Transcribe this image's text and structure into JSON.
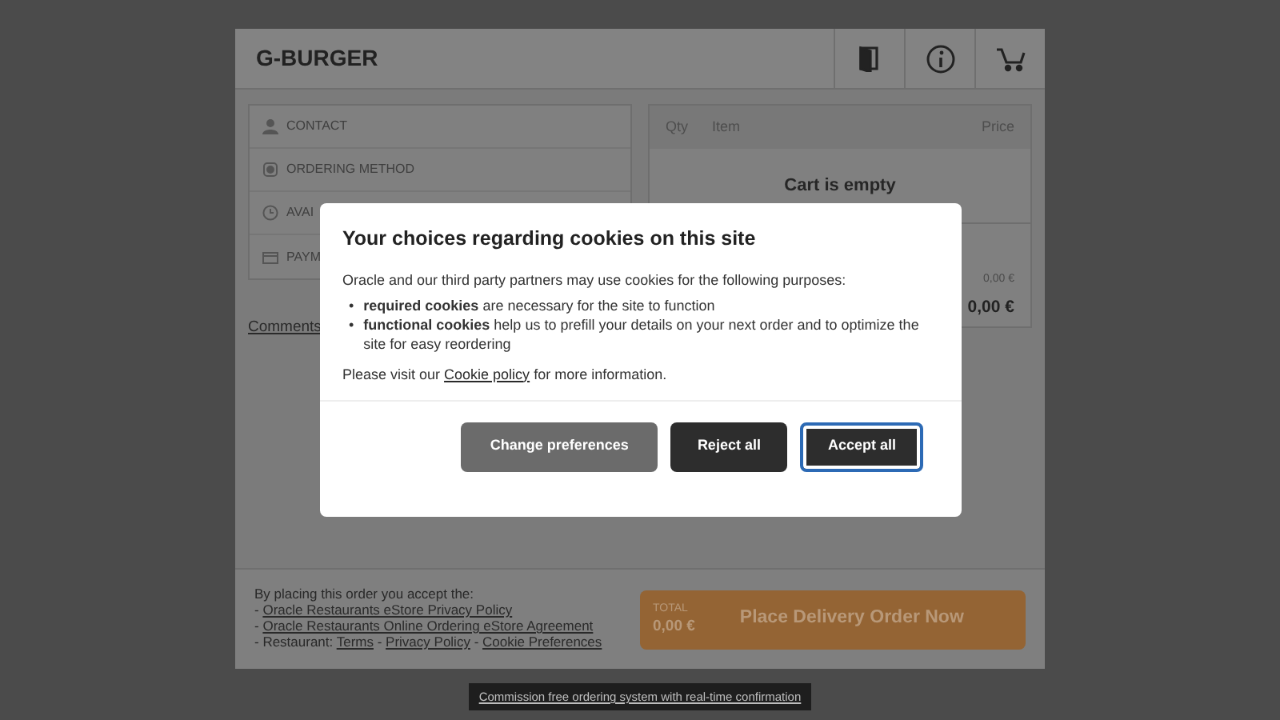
{
  "header": {
    "title": "G-BURGER",
    "buttons": [
      {
        "kind": "door"
      },
      {
        "kind": "info"
      },
      {
        "kind": "cart"
      }
    ]
  },
  "steps": [
    {
      "label": "CONTACT",
      "kind": "person"
    },
    {
      "label": "ORDERING METHOD",
      "kind": "bag"
    },
    {
      "label": "AVAI",
      "kind": "clock"
    },
    {
      "label": "PAYM",
      "kind": "card"
    }
  ],
  "comments_link": "Comments",
  "cart": {
    "columns": [
      "Qty",
      "Item",
      "Price"
    ],
    "empty_text": "Cart is empty",
    "subtotal": "0,00 €",
    "total": "0,00 €"
  },
  "terms": {
    "intro": "By placing this order you accept the:",
    "lines": [
      [
        {
          "text": "- "
        },
        {
          "text": "Oracle Restaurants eStore Privacy Policy",
          "link": true
        }
      ],
      [
        {
          "text": "- "
        },
        {
          "text": "Oracle Restaurants Online Ordering eStore Agreement",
          "link": true
        }
      ],
      [
        {
          "text": "- Restaurant: "
        },
        {
          "text": "Terms",
          "link": true
        },
        {
          "text": " - "
        },
        {
          "text": "Privacy Policy",
          "link": true
        },
        {
          "text": " - "
        },
        {
          "text": "Cookie Preferences",
          "link": true
        }
      ]
    ]
  },
  "order_button": {
    "total_label": "TOTAL",
    "total": "0,00 €",
    "label": "Place Delivery Order Now"
  },
  "footer_link": "Commission free ordering system with real-time confirmation",
  "cookie_dialog": {
    "title": "Your choices regarding cookies on this site",
    "intro": "Oracle and our third party partners may use cookies for the following purposes:",
    "purposes": [
      {
        "bullet": "•",
        "text": "**required cookies** are necessary for the site to function"
      },
      {
        "bullet": "•",
        "text": "**functional cookies** help us to prefill your details on your next order and to optimize the site for easy reordering"
      }
    ],
    "note": [
      {
        "text": "Please visit our "
      },
      {
        "text": "Cookie policy",
        "link": true
      },
      {
        "text": " for more information."
      }
    ],
    "buttons": [
      {
        "label": "Change preferences",
        "kind": "secondary",
        "focused": false
      },
      {
        "label": "Reject all",
        "kind": "dark",
        "focused": false
      },
      {
        "label": "Accept all",
        "kind": "dark",
        "focused": true
      }
    ]
  }
}
